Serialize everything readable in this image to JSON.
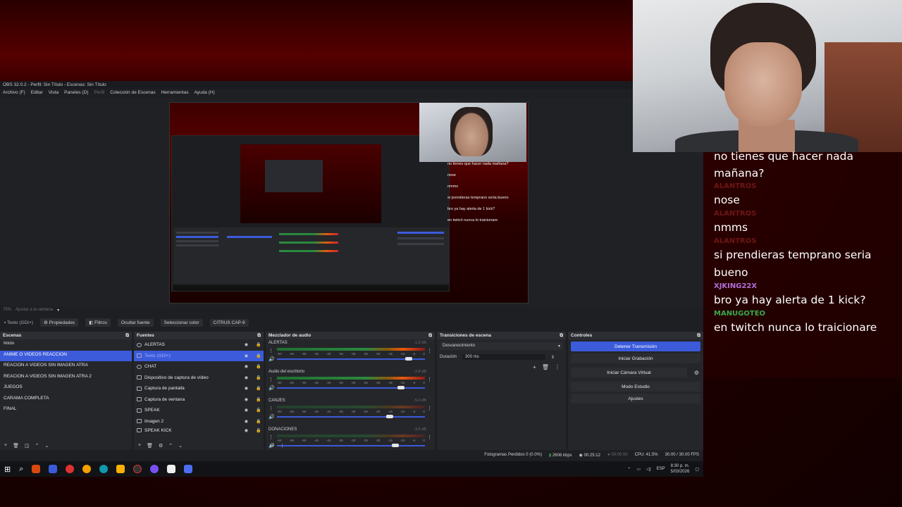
{
  "obs": {
    "title": "OBS 32.0.2 - Perfil: Sin Título - Escenas: Sin Título",
    "menu": [
      "Archivo (F)",
      "Editar",
      "Vista",
      "Paneles (D)",
      "Perfil",
      "Colección de Escenas",
      "Herramientas",
      "Ayuda (H)"
    ],
    "zoom": "75%",
    "zoom_option": "Ajustar a la ventana",
    "selected_source": "Texto (GDI+)",
    "toolbar": {
      "properties": "Propiedades",
      "filters": "Filtros",
      "hide_source": "Ocultar fuente",
      "select_color": "Seleccionar color",
      "source_name": "CITRUS CAP-9"
    },
    "scenes": {
      "title": "Escenas",
      "items": [
        "Inicio",
        "ANIME O VIDEOS REACCION",
        "REACION A VIDEOS SIN IMAGEN ATRA",
        "REACION A VIDEOS SIN IMAGEN ATRA 2",
        "JUEGOS",
        "CARAMA COMPLETA",
        "FINAL"
      ],
      "active_index": 1
    },
    "sources": {
      "title": "Fuentes",
      "items": [
        "ALERTAS",
        "Texto (GDI+)",
        "CHAT",
        "Dispositivo de captura de vídeo",
        "Captura de pantalla",
        "Captura de ventana",
        "SPEAK",
        "Imagen 2",
        "SPEAK KICK"
      ],
      "active_index": 1
    },
    "mixer": {
      "title": "Mezclador de audio",
      "channels": [
        {
          "name": "ALERTAS",
          "db": "-1.5 dB",
          "level": 0.89,
          "dimmed": false
        },
        {
          "name": "Audio del escritorio",
          "db": "-2.8 dB",
          "level": 0.84,
          "dimmed": false
        },
        {
          "name": "CANJES",
          "db": "-5.0 dB",
          "level": 0.76,
          "dimmed": true
        },
        {
          "name": "DONACIONES",
          "db": "-3.5 dB",
          "level": 0.8,
          "dimmed": true
        }
      ],
      "ticks": [
        "-60",
        "-55",
        "-50",
        "-45",
        "-40",
        "-35",
        "-30",
        "-25",
        "-20",
        "-15",
        "-10",
        "-5",
        "0"
      ]
    },
    "transitions": {
      "title": "Transiciones de escena",
      "selected": "Desvanecimiento",
      "duration_label": "Duración",
      "duration_value": "300 ms"
    },
    "controls": {
      "title": "Controles",
      "stop_stream": "Detener Transmisión",
      "start_recording": "Iniciar Grabación",
      "start_virtual_cam": "Iniciar Cámara Virtual",
      "studio_mode": "Modo Estudio",
      "settings": "Ajustes"
    },
    "status": {
      "dropped_frames": "Fotogramas Perdidos 0 (0.0%)",
      "bitrate": "2606 kbps",
      "live_time": "00:25:12",
      "rec_time": "00:00:00",
      "cpu": "CPU: 41.5%",
      "fps": "30.00 / 30.00 FPS"
    }
  },
  "taskbar": {
    "lang": "ESP",
    "time": "8:30 p. m.",
    "date": "5/03/2026"
  },
  "preview_chat": [
    {
      "user": "",
      "text": "no tienes que hacer nada mañana?"
    },
    {
      "user": "",
      "text": "nose"
    },
    {
      "user": "",
      "text": "nmms"
    },
    {
      "user": "",
      "text": "si prendieras temprano seria bueno"
    },
    {
      "user": "",
      "text": "bro ya hay alerta de 1 kick?"
    },
    {
      "user": "",
      "text": "en twitch nunca lo traicionare"
    }
  ],
  "chat": [
    {
      "user": "",
      "text": "no tienes que hacer nada mañana?",
      "color": "#6e1515"
    },
    {
      "user": "ALANTROS",
      "text": "nose",
      "color": "#6e1515"
    },
    {
      "user": "ALANTROS",
      "text": "nmms",
      "color": "#6e1515"
    },
    {
      "user": "ALANTROS",
      "text": "si prendieras temprano seria bueno",
      "color": "#6e1515"
    },
    {
      "user": "XJKING22X",
      "text": "bro ya hay alerta de 1 kick?",
      "color": "#b06fd8"
    },
    {
      "user": "MANUGOTEO",
      "text": "en twitch nunca lo traicionare",
      "color": "#3aa84e"
    }
  ]
}
